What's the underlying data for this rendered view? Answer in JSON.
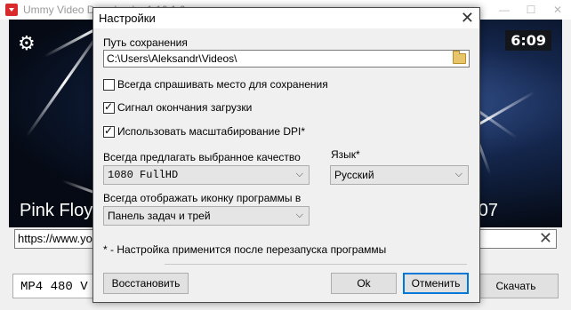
{
  "app": {
    "title": "Ummy Video Downloader 1.10.1.0",
    "video": {
      "duration": "6:09",
      "title_start": "Pink Floyd",
      "title_end": "007"
    },
    "url_value": "https://www.yo",
    "format_value": "MP4  480  V",
    "download_label": "Скачать",
    "window_buttons": {
      "minimize": "—",
      "maximize": "☐",
      "close": "✕"
    }
  },
  "dialog": {
    "title": "Настройки",
    "close_glyph": "✕",
    "save_path_label": "Путь сохранения",
    "save_path_value": "C:\\Users\\Aleksandr\\Videos\\",
    "checkboxes": [
      {
        "label": "Всегда спрашивать место для сохранения",
        "checked": false
      },
      {
        "label": "Сигнал окончания загрузки",
        "checked": true
      },
      {
        "label": "Использовать масштабирование DPI*",
        "checked": true
      }
    ],
    "quality_label": "Всегда предлагать выбранное качество",
    "quality_value": "1080 FullHD",
    "language_label": "Язык*",
    "language_value": "Русский",
    "icon_label": "Всегда отображать иконку программы в",
    "icon_value": "Панель задач и трей",
    "footnote": "* - Настройка применится после перезапуска программы",
    "restore_label": "Восстановить",
    "ok_label": "Ok",
    "cancel_label": "Отменить"
  },
  "icons": {
    "gear": "⚙",
    "chevron": "⌵"
  },
  "colors": {
    "accent": "#0078d7",
    "app_icon": "#d92b2b"
  }
}
